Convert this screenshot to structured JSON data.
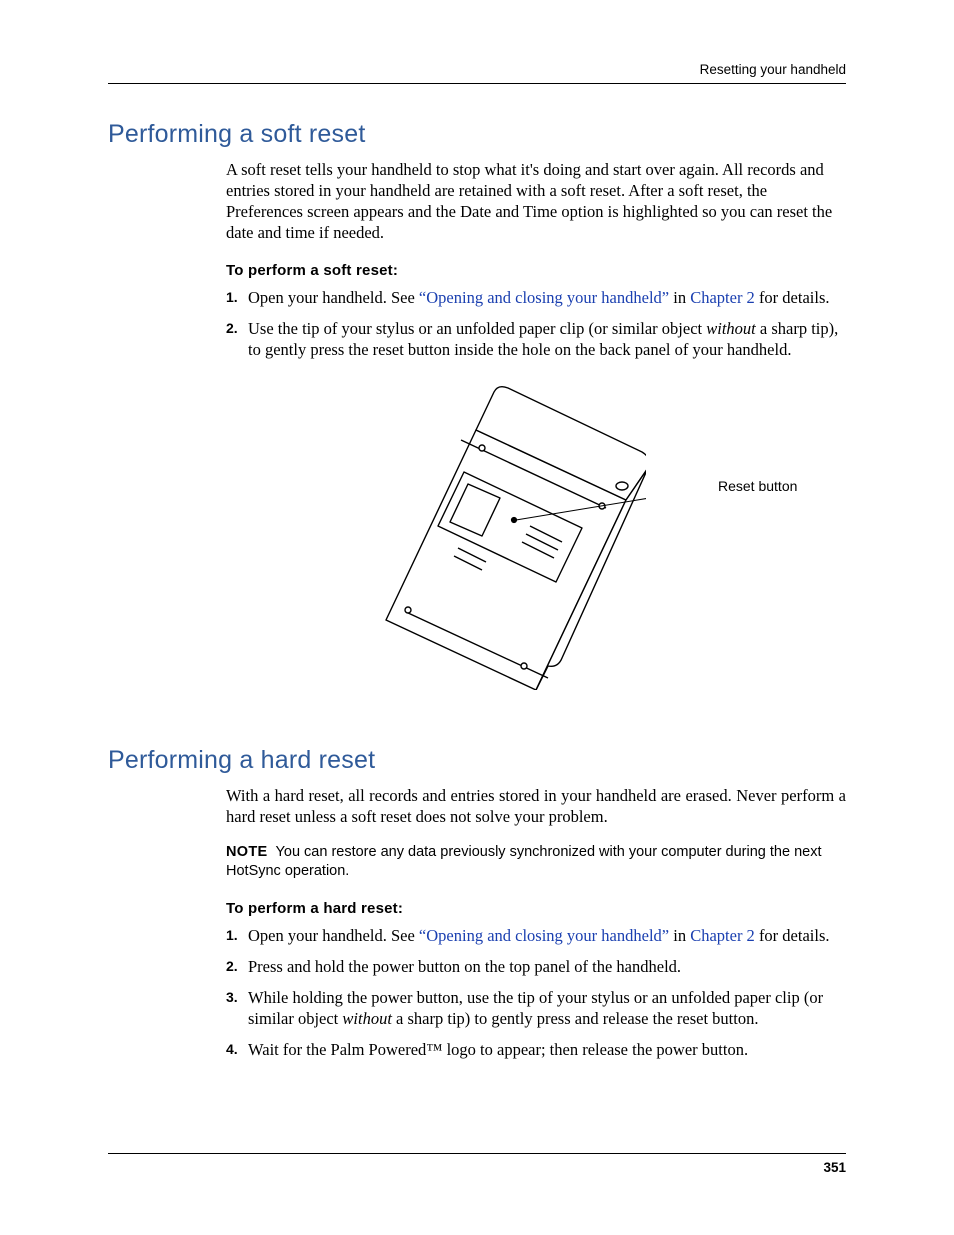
{
  "header": {
    "running_head": "Resetting your handheld"
  },
  "section1": {
    "title": "Performing a soft reset",
    "intro": "A soft reset tells your handheld to stop what it's doing and start over again. All records and entries stored in your handheld are retained with a soft reset. After a soft reset, the Preferences screen appears and the Date and Time option is highlighted so you can reset the date and time if needed.",
    "subhead": "To perform a soft reset:",
    "steps": [
      {
        "num": "1.",
        "pre": "Open your handheld. See ",
        "link1": "“Opening and closing your handheld”",
        "mid": " in ",
        "link2": "Chapter 2",
        "post": " for details."
      },
      {
        "num": "2.",
        "pre": "Use the tip of your stylus or an unfolded paper clip (or similar object ",
        "ital": "without",
        "post": " a sharp tip), to gently press the reset button inside the hole on the back panel of your handheld."
      }
    ],
    "callout": "Reset button"
  },
  "section2": {
    "title": "Performing a hard reset",
    "intro": "With a hard reset, all records and entries stored in your handheld are erased. Never perform a hard reset unless a soft reset does not solve your problem.",
    "note_label": "NOTE",
    "note_text": "You can restore any data previously synchronized with your computer during the next HotSync operation.",
    "subhead": "To perform a hard reset:",
    "steps": [
      {
        "num": "1.",
        "pre": "Open your handheld. See ",
        "link1": "“Opening and closing your handheld”",
        "mid": " in ",
        "link2": "Chapter 2",
        "post": " for details."
      },
      {
        "num": "2.",
        "text": "Press and hold the power button on the top panel of the handheld."
      },
      {
        "num": "3.",
        "pre": "While holding the power button, use the tip of your stylus or an unfolded paper clip (or similar object ",
        "ital": "without",
        "post": " a sharp tip) to gently press and release the reset button."
      },
      {
        "num": "4.",
        "text": "Wait for the Palm Powered™ logo to appear; then release the power button."
      }
    ]
  },
  "footer": {
    "page_number": "351"
  }
}
